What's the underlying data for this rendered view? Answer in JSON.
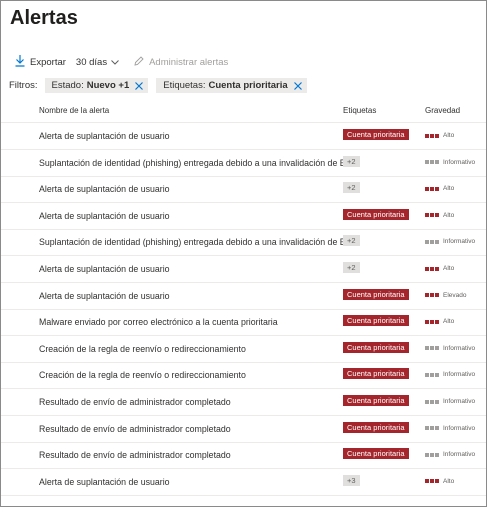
{
  "page": {
    "title": "Alertas"
  },
  "toolbar": {
    "export_label": "Exportar",
    "range_label": "30 días",
    "manage_label": "Administrar alertas"
  },
  "filters": {
    "label": "Filtros:",
    "chips": [
      {
        "key": "Estado:",
        "value": "Nuevo +1"
      },
      {
        "key": "Etiquetas:",
        "value": "Cuenta prioritaria"
      }
    ]
  },
  "table": {
    "headers": {
      "name": "Nombre de la alerta",
      "tags": "Etiquetas",
      "severity": "Gravedad"
    },
    "rows": [
      {
        "name": "Alerta de suplantación de usuario",
        "tag": "Cuenta prioritaria",
        "tag_type": "priority",
        "severity": "Alto",
        "level": 3
      },
      {
        "name": "Suplantación de identidad (phishing) entregada debido a una invalidación de ETR",
        "tag": "+2",
        "tag_type": "count",
        "severity": "Informativo",
        "level": 0
      },
      {
        "name": "Alerta de suplantación de usuario",
        "tag": "+2",
        "tag_type": "count",
        "severity": "Alto",
        "level": 3
      },
      {
        "name": "Alerta de suplantación de usuario",
        "tag": "Cuenta prioritaria",
        "tag_type": "priority",
        "severity": "Alto",
        "level": 3
      },
      {
        "name": "Suplantación de identidad (phishing) entregada debido a una invalidación de ETR",
        "tag": "+2",
        "tag_type": "count",
        "severity": "Informativo",
        "level": 0
      },
      {
        "name": "Alerta de suplantación de usuario",
        "tag": "+2",
        "tag_type": "count",
        "severity": "Alto",
        "level": 3
      },
      {
        "name": "Alerta de suplantación de usuario",
        "tag": "Cuenta prioritaria",
        "tag_type": "priority",
        "severity": "Elevado",
        "level": 3
      },
      {
        "name": "Malware enviado por correo electrónico a la cuenta prioritaria",
        "tag": "Cuenta prioritaria",
        "tag_type": "priority",
        "severity": "Alto",
        "level": 3
      },
      {
        "name": "Creación de la regla de reenvío o redireccionamiento",
        "tag": "Cuenta prioritaria",
        "tag_type": "priority",
        "severity": "Informativo",
        "level": 0
      },
      {
        "name": "Creación de la regla de reenvío o redireccionamiento",
        "tag": "Cuenta prioritaria",
        "tag_type": "priority",
        "severity": "Informativo",
        "level": 0
      },
      {
        "name": "Resultado de envío de administrador completado",
        "tag": "Cuenta prioritaria",
        "tag_type": "priority",
        "severity": "Informativo",
        "level": 0
      },
      {
        "name": "Resultado de envío de administrador completado",
        "tag": "Cuenta prioritaria",
        "tag_type": "priority",
        "severity": "Informativo",
        "level": 0
      },
      {
        "name": "Resultado de envío de administrador completado",
        "tag": "Cuenta prioritaria",
        "tag_type": "priority",
        "severity": "Informativo",
        "level": 0
      },
      {
        "name": "Alerta de suplantación de usuario",
        "tag": "+3",
        "tag_type": "count",
        "severity": "Alto",
        "level": 3
      }
    ]
  },
  "colors": {
    "severity_on": "#a4262c",
    "severity_off": "#a19f9d",
    "accent": "#0078d4"
  }
}
